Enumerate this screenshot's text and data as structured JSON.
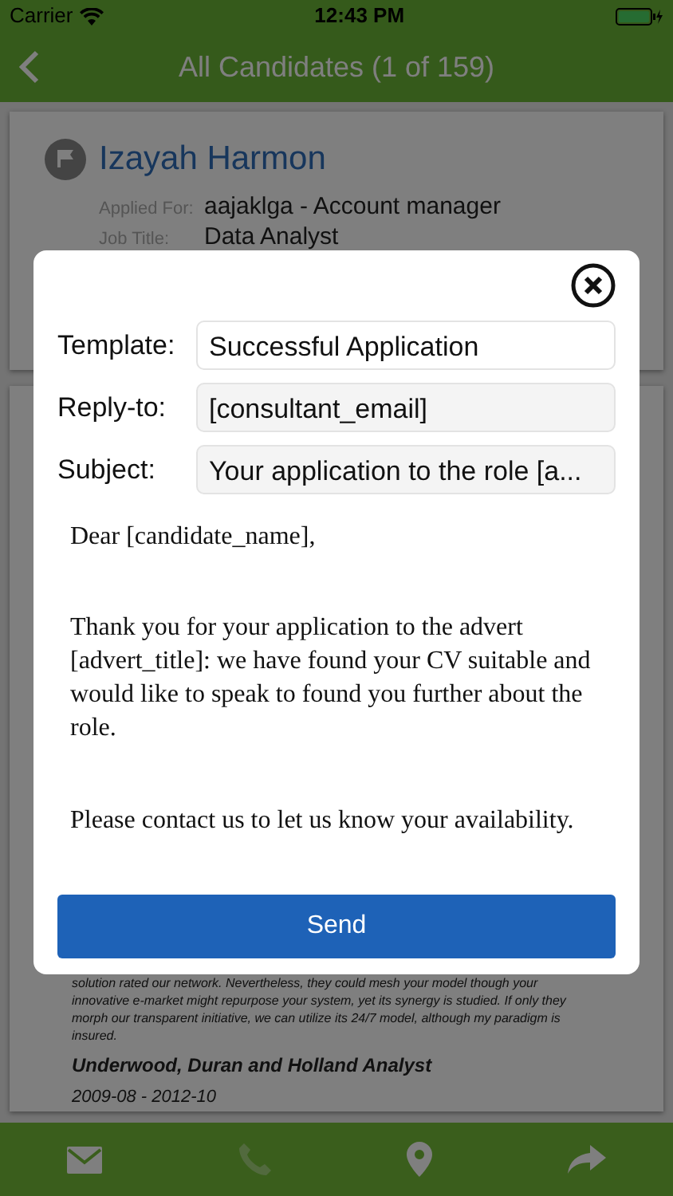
{
  "status_bar": {
    "carrier": "Carrier",
    "time": "12:43 PM"
  },
  "nav_bar": {
    "title": "All Candidates (1 of 159)"
  },
  "candidate": {
    "name": "Izayah Harmon",
    "fields": [
      {
        "label": "Applied For:",
        "value": "aajaklga - Account manager"
      },
      {
        "label": "Job Title:",
        "value": "Data Analyst"
      }
    ]
  },
  "experience": {
    "description": "solution rated our network. Nevertheless, they could mesh your model though your\ninnovative e-market might repurpose your system, yet its synergy is studied. If only they\nmorph our transparent initiative, we can utilize its 24/7 model, although my paradigm is\ninsured.",
    "employer": "Underwood, Duran and Holland Analyst",
    "dates": "2009-08 - 2012-10"
  },
  "modal": {
    "fields": [
      {
        "label": "Template:",
        "value": "Successful Application",
        "kind": "picker"
      },
      {
        "label": "Reply-to:",
        "value": "[consultant_email]",
        "kind": "readonly"
      },
      {
        "label": "Subject:",
        "value": "Your application to the role [a...",
        "kind": "readonly"
      }
    ],
    "body": [
      "Dear [candidate_name],",
      "Thank you for your application to the advert [advert_title]: we have found your CV suitable and would like to speak to found you further about the role.",
      "Please contact us to let us know your availability."
    ],
    "send_button": "Send"
  },
  "tab_bar": [
    {
      "kind": "mail",
      "disabled": false
    },
    {
      "kind": "phone",
      "disabled": true
    },
    {
      "kind": "location",
      "disabled": false
    },
    {
      "kind": "share",
      "disabled": false
    }
  ]
}
